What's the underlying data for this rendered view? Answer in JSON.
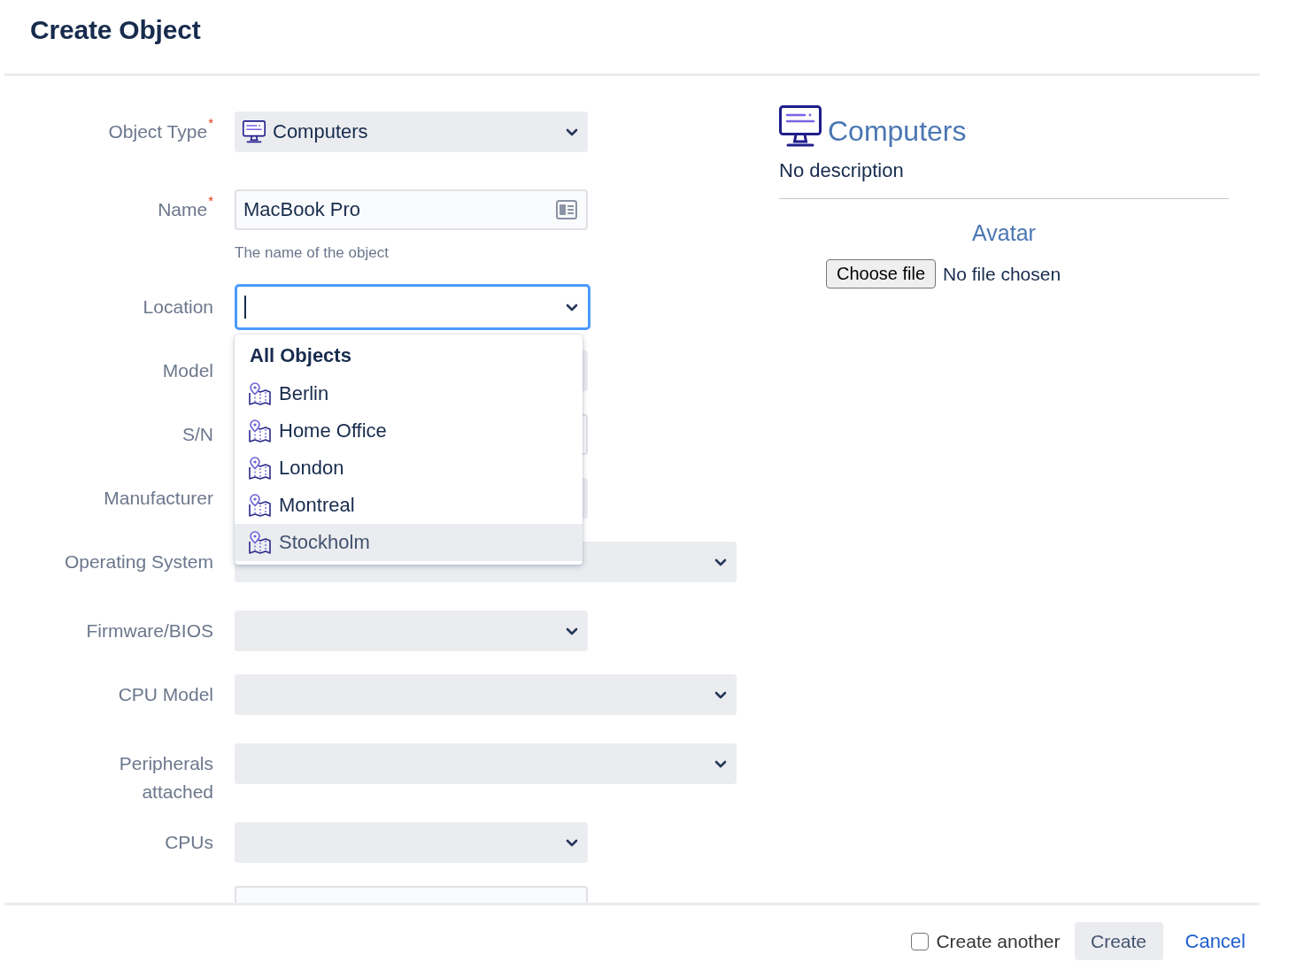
{
  "title": "Create Object",
  "form": {
    "fields": [
      {
        "kind": "select",
        "label": "Object Type$^{*}$",
        "value": "Computers"
      },
      {
        "kind": "text",
        "label": "Name$^{*}$",
        "value": "MacBook Pro",
        "help": "The name of the object"
      },
      {
        "kind": "select",
        "label": "Location",
        "focused": true,
        "menu": {
          "heading": "All Objects",
          "items": [
            {
              "label": "Berlin",
              "selected": false
            },
            {
              "label": "Home Office",
              "selected": false
            },
            {
              "label": "London",
              "selected": false
            },
            {
              "label": "Montreal",
              "selected": false
            },
            {
              "label": "Stockholm",
              "selected": true
            }
          ]
        }
      },
      {
        "kind": "select",
        "label": "Model",
        "covered": true
      },
      {
        "kind": "text",
        "label": "S/N",
        "covered": true
      },
      {
        "kind": "select",
        "label": "Manufacturer",
        "covered": true
      },
      {
        "kind": "multi-select",
        "label": "Operating System"
      },
      {
        "kind": "select",
        "label": "Firmware/BIOS"
      },
      {
        "kind": "multi-select",
        "label": "CPU Model"
      },
      {
        "kind": "multi-select",
        "label": "Peripherals attached"
      },
      {
        "kind": "select",
        "label": "CPUs"
      },
      {
        "kind": "text"
      }
    ]
  },
  "type_panel": {
    "title": "Computers",
    "description": "No description",
    "avatar": {
      "heading": "Avatar",
      "button": "Choose file",
      "status": "No file chosen"
    }
  },
  "footer": {
    "create_another": {
      "label": "Create another",
      "checked": false
    },
    "buttons": [
      {
        "label": "Create",
        "kind": "button"
      },
      {
        "label": "Cancel",
        "kind": "link"
      }
    ]
  }
}
